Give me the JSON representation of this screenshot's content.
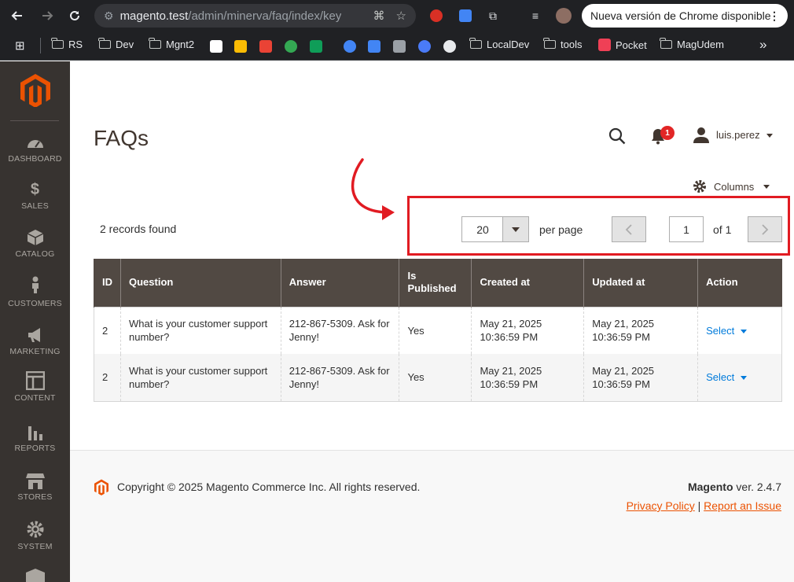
{
  "browser": {
    "url_host": "magento.test",
    "url_path": "/admin/minerva/faq/index/key...",
    "update_banner": "Nueva versión de Chrome disponible",
    "bookmarks": [
      "RS",
      "Dev",
      "Mgnt2",
      "LocalDev",
      "tools",
      "Pocket",
      "MagUdem"
    ],
    "overflow": "»"
  },
  "sidebar": {
    "items": [
      {
        "label": "DASHBOARD",
        "icon": "dashboard-icon"
      },
      {
        "label": "SALES",
        "icon": "dollar-icon"
      },
      {
        "label": "CATALOG",
        "icon": "box-icon"
      },
      {
        "label": "CUSTOMERS",
        "icon": "person-icon"
      },
      {
        "label": "MARKETING",
        "icon": "megaphone-icon"
      },
      {
        "label": "CONTENT",
        "icon": "layout-icon"
      },
      {
        "label": "REPORTS",
        "icon": "bar-chart-icon"
      },
      {
        "label": "STORES",
        "icon": "store-icon"
      },
      {
        "label": "SYSTEM",
        "icon": "gear-icon"
      }
    ]
  },
  "header": {
    "title": "FAQs",
    "notifications_count": "1",
    "username": "luis.perez"
  },
  "toolbar": {
    "columns_label": "Columns",
    "records_found": "2 records found",
    "per_page_value": "20",
    "per_page_label": "per page",
    "current_page": "1",
    "page_of": "of 1"
  },
  "table": {
    "headers": [
      "ID",
      "Question",
      "Answer",
      "Is Published",
      "Created at",
      "Updated at",
      "Action"
    ],
    "rows": [
      {
        "id": "2",
        "question": "What is your customer support number?",
        "answer": "212-867-5309. Ask for Jenny!",
        "published": "Yes",
        "created": "May 21, 2025 10:36:59 PM",
        "updated": "May 21, 2025 10:36:59 PM",
        "action": "Select"
      },
      {
        "id": "2",
        "question": "What is your customer support number?",
        "answer": "212-867-5309. Ask for Jenny!",
        "published": "Yes",
        "created": "May 21, 2025 10:36:59 PM",
        "updated": "May 21, 2025 10:36:59 PM",
        "action": "Select"
      }
    ]
  },
  "footer": {
    "copyright": "Copyright © 2025 Magento Commerce Inc. All rights reserved.",
    "brand": "Magento",
    "version": " ver. 2.4.7",
    "privacy_link": "Privacy Policy",
    "separator": " | ",
    "report_link": "Report an Issue"
  },
  "colors": {
    "sidebar_bg": "#373330",
    "accent": "#eb5202",
    "table_header_bg": "#514943",
    "link": "#007bdb",
    "highlight": "#e11b22"
  }
}
